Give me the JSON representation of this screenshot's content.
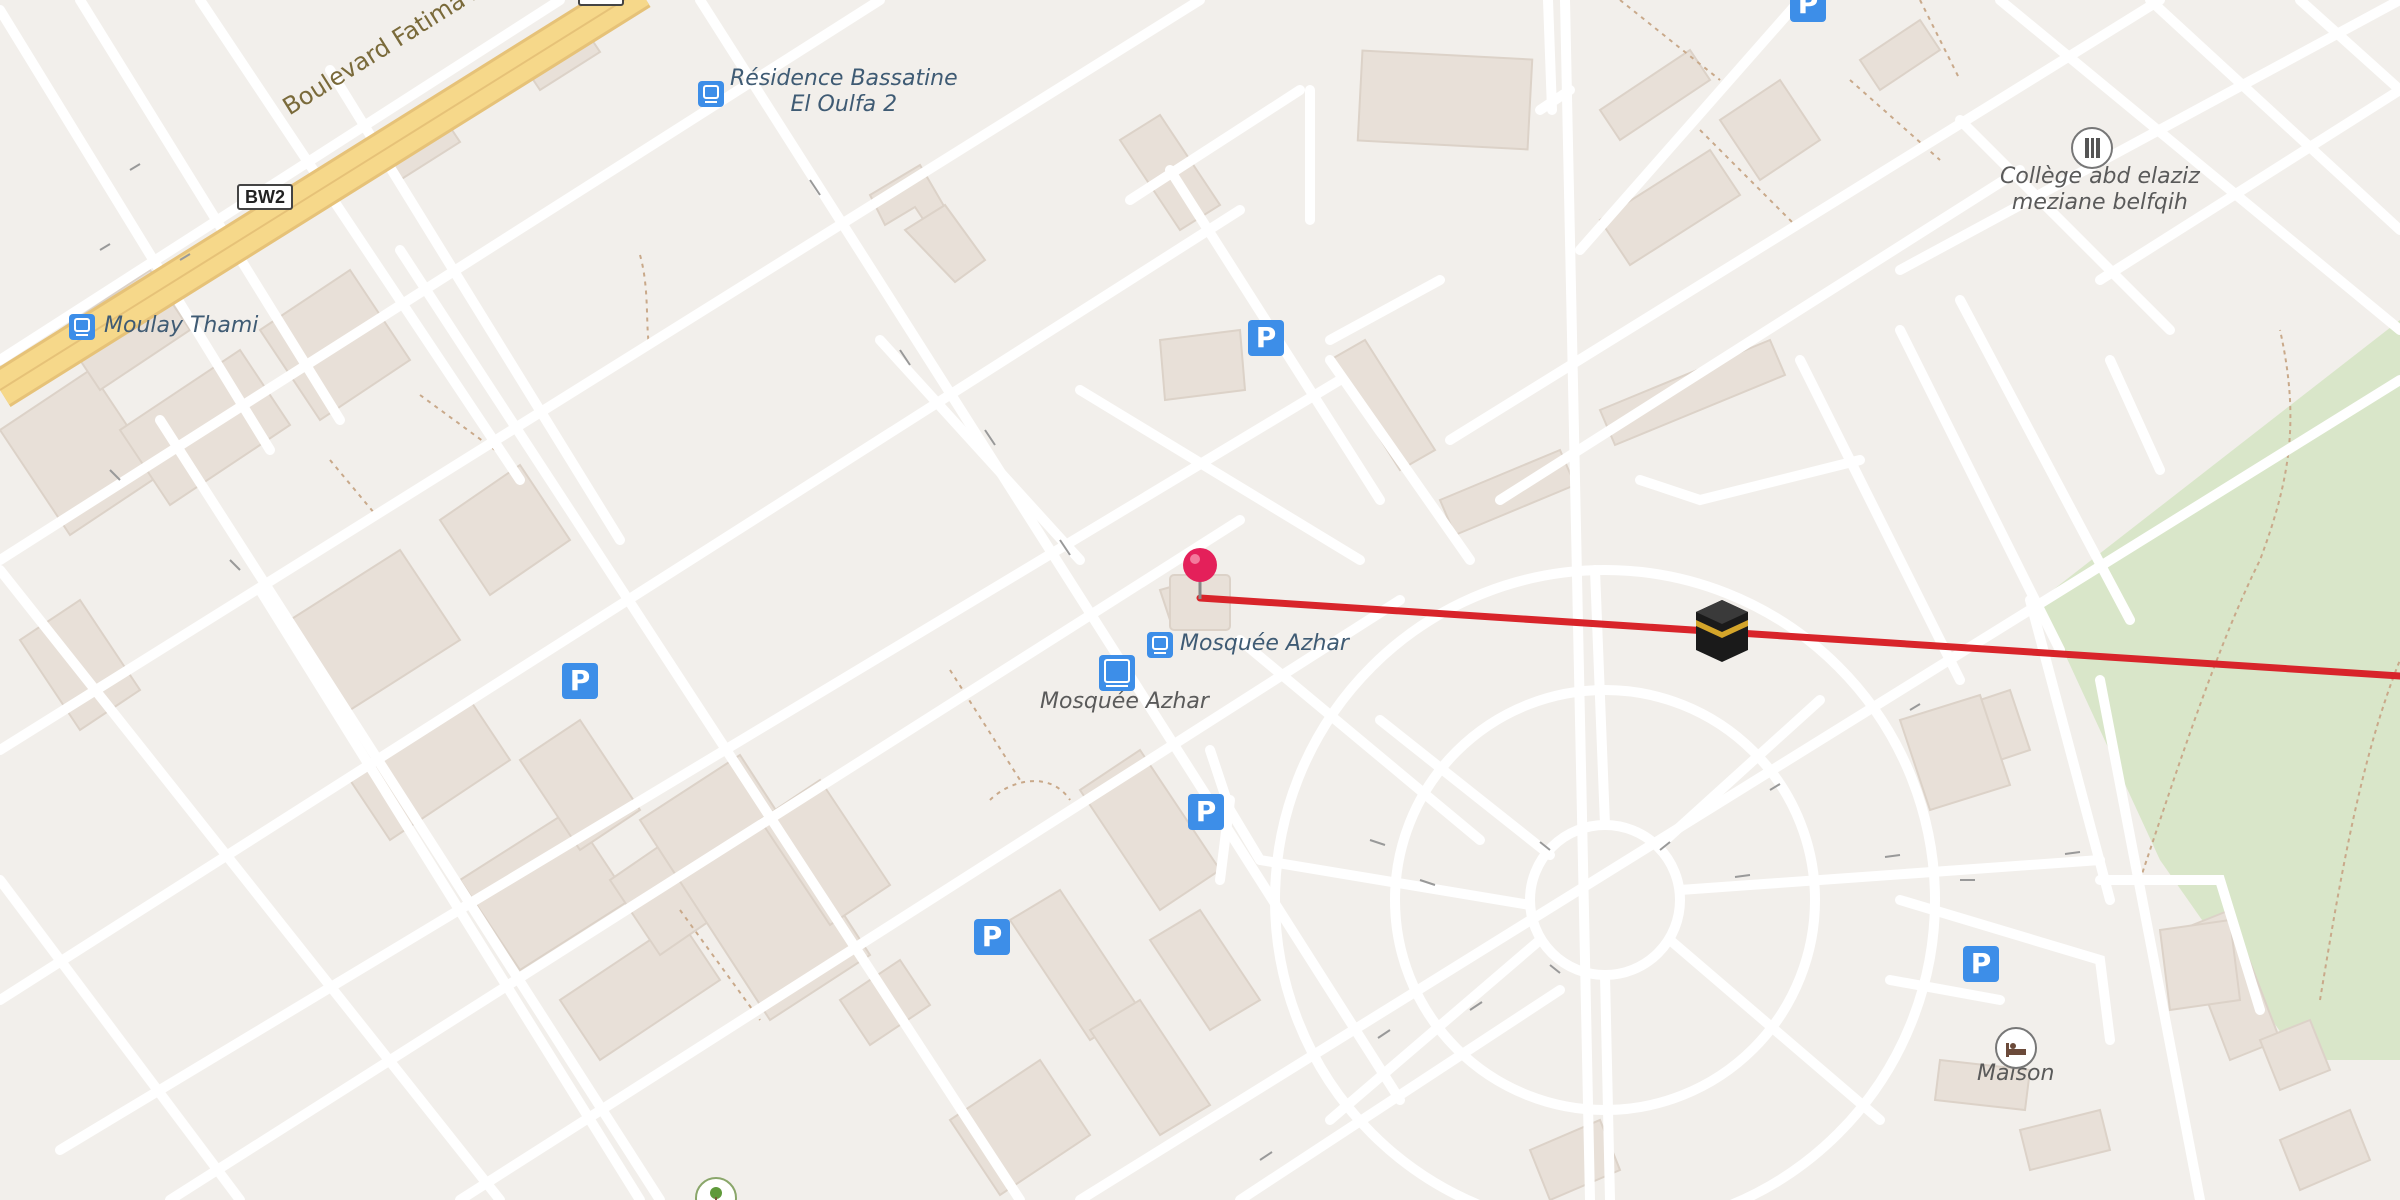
{
  "map": {
    "labels": {
      "residence": "Résidence Bassatine",
      "residence_line2": "El Oulfa 2",
      "moulay_thami": "Moulay Thami",
      "mosquee_stop": "Mosquée Azhar",
      "mosquee_bus": "Mosquée Azhar",
      "college": "Collège abd elaziz",
      "college_line2": "meziane belfqih",
      "maison": "Maison",
      "boulevard": "Boulevard Fatima Aouam",
      "route_shield": "BW2"
    },
    "parking_letter": "P",
    "colors": {
      "background": "#f2efeb",
      "road": "#ffffff",
      "building": "#e8e0d8",
      "park": "#d9e6c9",
      "boulevard": "#f6d88a",
      "qibla_line": "#d8242a",
      "pin": "#e4205a",
      "parking": "#3d8ee8",
      "label": "#3f5b74"
    },
    "icons": [
      "pin-marker-icon",
      "kaaba-icon",
      "parking-icon",
      "bus-stop-icon",
      "school-icon",
      "hotel-icon",
      "park-icon"
    ]
  }
}
